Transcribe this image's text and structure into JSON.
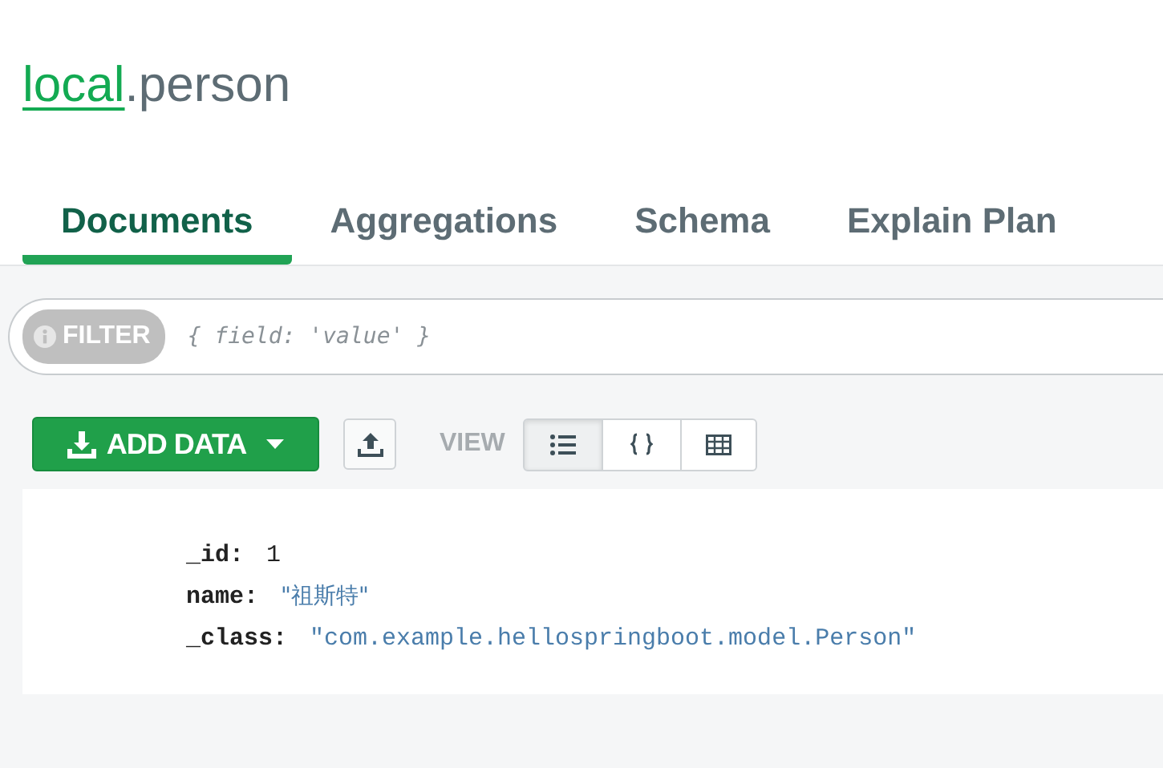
{
  "title": {
    "database": "local",
    "collection": ".person"
  },
  "tabs": [
    {
      "label": "Documents",
      "selected": true
    },
    {
      "label": "Aggregations",
      "selected": false
    },
    {
      "label": "Schema",
      "selected": false
    },
    {
      "label": "Explain Plan",
      "selected": false
    }
  ],
  "filter": {
    "label": "FILTER",
    "placeholder": "{ field: 'value' }"
  },
  "toolbar": {
    "add_data": "ADD DATA",
    "view_label": "VIEW",
    "views": [
      {
        "kind": "list",
        "selected": true
      },
      {
        "kind": "json",
        "selected": false
      },
      {
        "kind": "table",
        "selected": false
      }
    ]
  },
  "document": {
    "fields": [
      {
        "key": "_id:",
        "value": "1",
        "kind": "number"
      },
      {
        "key": "name:",
        "value": "\"祖斯特\"",
        "kind": "string"
      },
      {
        "key": "_class:",
        "value": "\"com.example.hellospringboot.model.Person\"",
        "kind": "string"
      }
    ]
  }
}
